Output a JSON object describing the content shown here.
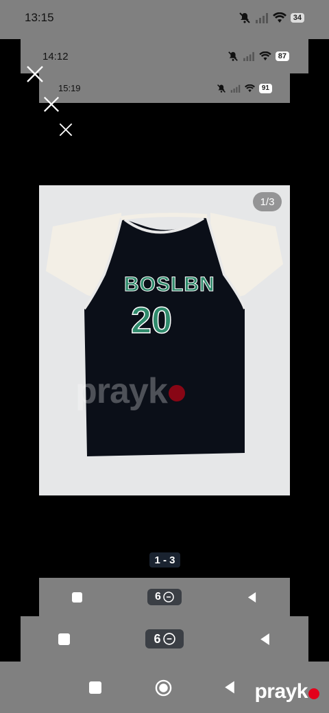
{
  "status_bars": [
    {
      "time": "13:15",
      "battery": "34"
    },
    {
      "time": "14:12",
      "battery": "87"
    },
    {
      "time": "15:19",
      "battery": "91"
    }
  ],
  "gallery": {
    "counter": "1/3",
    "page_indicator": "1 - 3",
    "jersey_text": "BOSLBN",
    "jersey_number": "20",
    "watermark": "prayk"
  },
  "nav": {
    "recents_count": "6"
  },
  "brand": {
    "name": "prayk"
  },
  "colors": {
    "overlay_gray": "#808080",
    "jersey_green": "#2f8a6b",
    "brand_red": "#e3001b"
  }
}
